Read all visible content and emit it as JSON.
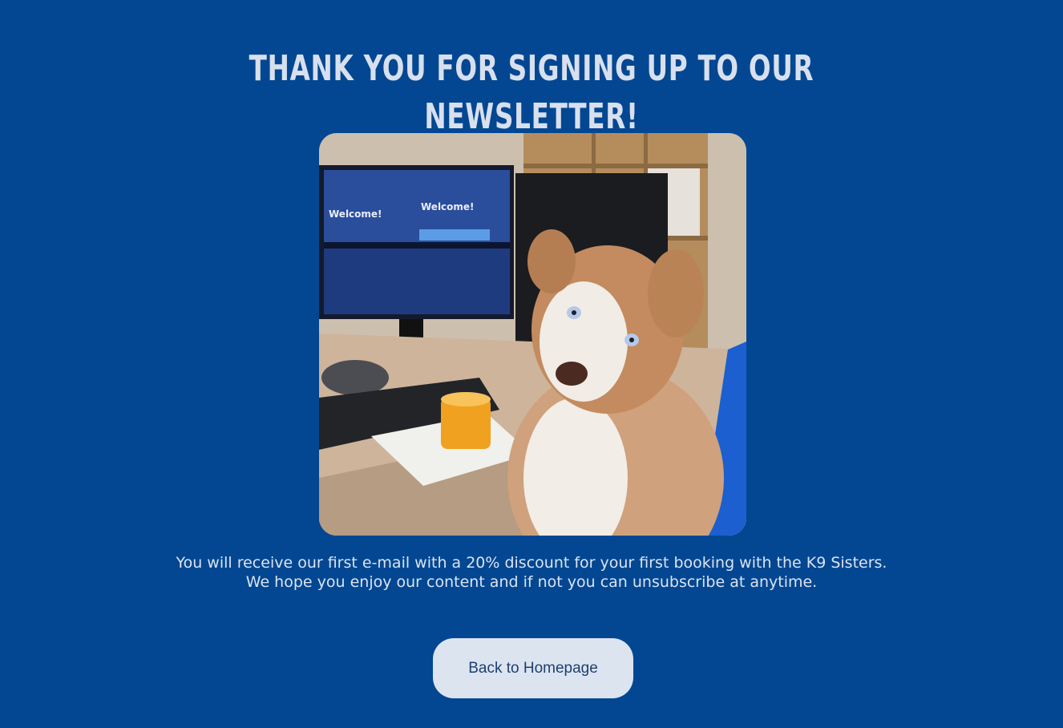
{
  "page": {
    "title": "THANK YOU FOR SIGNING UP TO OUR NEWSLETTER!",
    "message_line_1": "You will receive our first e-mail with a 20% discount for your first booking with the K9 Sisters.",
    "message_line_2": "We hope you enjoy our content and if not you can unsubscribe at anytime.",
    "button_label": "Back to Homepage"
  },
  "image": {
    "screen_text_1": "Welcome!",
    "screen_text_2": "Welcome!"
  },
  "colors": {
    "background": "#034792",
    "text": "#dbe3f0",
    "button_bg": "#dce4f0",
    "button_text": "#1d3f70"
  }
}
